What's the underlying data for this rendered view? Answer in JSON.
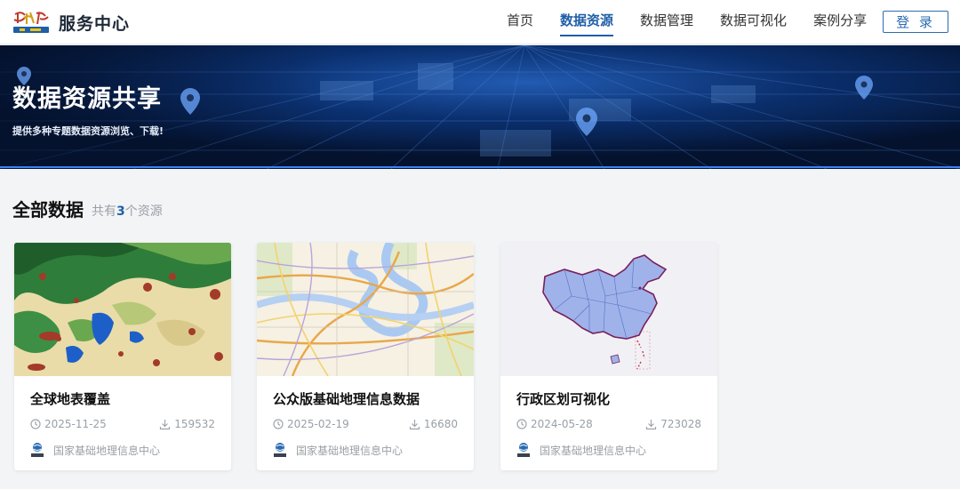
{
  "header": {
    "brand": "服务中心",
    "nav": [
      {
        "label": "首页",
        "active": false
      },
      {
        "label": "数据资源",
        "active": true
      },
      {
        "label": "数据管理",
        "active": false
      },
      {
        "label": "数据可视化",
        "active": false
      },
      {
        "label": "案例分享",
        "active": false
      }
    ],
    "login_label": "登 录"
  },
  "banner": {
    "title": "数据资源共享",
    "subtitle": "提供多种专题数据资源浏览、下载!"
  },
  "section": {
    "title": "全部数据",
    "count_prefix": "共有",
    "count": "3",
    "count_suffix": "个资源"
  },
  "cards": [
    {
      "title": "全球地表覆盖",
      "date": "2025-11-25",
      "downloads": "159532",
      "org": "国家基础地理信息中心"
    },
    {
      "title": "公众版基础地理信息数据",
      "date": "2025-02-19",
      "downloads": "16680",
      "org": "国家基础地理信息中心"
    },
    {
      "title": "行政区划可视化",
      "date": "2024-05-28",
      "downloads": "723028",
      "org": "国家基础地理信息中心"
    }
  ],
  "colors": {
    "accent": "#1f5fa6",
    "banner": "#061a3d"
  },
  "icons": [
    "tianditu-logo",
    "map-pin-icon",
    "clock-icon",
    "download-icon",
    "ngcc-logo-icon"
  ]
}
